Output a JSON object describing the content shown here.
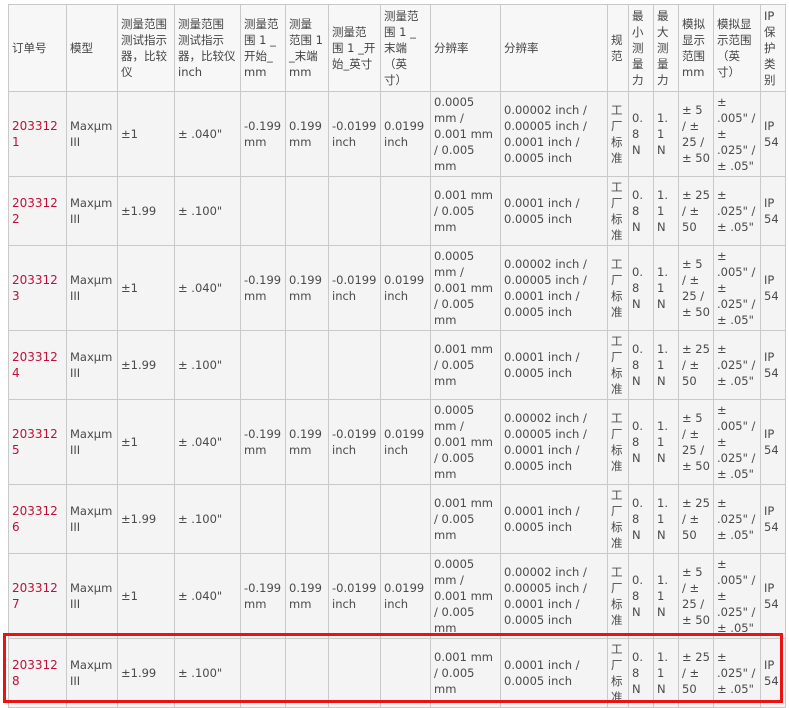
{
  "headers": [
    "订单号",
    "模型",
    "测量范围 测试指示器，比较仪",
    "测量范围 测试指示器，比较仪 inch",
    "测量范 围 1 _开始_ mm",
    "测量 范围 1 _末端 mm",
    "测量范 围 1 _开 始_英寸",
    "测量范 围 1 _ 末端 （英 寸）",
    "分辨率",
    "分辨率",
    "规 范",
    "最 小 测 量 力",
    "最 大 测 量 力",
    "模拟 显示 范围 mm",
    "模拟显 示范围 （英 寸）",
    "IP 保 护 类 别"
  ],
  "rows": [
    [
      "2033121",
      "Maxµm III",
      "±1",
      "± .040\"",
      "-0.199 mm",
      "0.199 mm",
      "-0.0199 inch",
      "0.0199 inch",
      "0.0005 mm / 0.001 mm / 0.005 mm",
      "0.00002 inch / 0.00005 inch / 0.0001 inch / 0.0005 inch",
      "工厂标准",
      "0.8 N",
      "1.1 N",
      "± 5 / ± 25 / ± 50",
      "± .005\" / ± .025\" / ± .05\"",
      "IP 54"
    ],
    [
      "2033122",
      "Maxµm III",
      "±1.99",
      "± .100\"",
      "",
      "",
      "",
      "",
      "0.001 mm / 0.005 mm",
      "0.0001 inch / 0.0005 inch",
      "工厂标准",
      "0.8 N",
      "1.1 N",
      "± 25 / ± 50",
      "± .025\" / ± .05\"",
      "IP 54"
    ],
    [
      "2033123",
      "Maxµm III",
      "±1",
      "± .040\"",
      "-0.199 mm",
      "0.199 mm",
      "-0.0199 inch",
      "0.0199 inch",
      "0.0005 mm / 0.001 mm / 0.005 mm",
      "0.00002 inch / 0.00005 inch / 0.0001 inch / 0.0005 inch",
      "工厂标准",
      "0.8 N",
      "1.1 N",
      "± 5 / ± 25 / ± 50",
      "± .005\" / ± .025\" / ± .05\"",
      "IP 54"
    ],
    [
      "2033124",
      "Maxµm III",
      "±1.99",
      "± .100\"",
      "",
      "",
      "",
      "",
      "0.001 mm / 0.005 mm",
      "0.0001 inch / 0.0005 inch",
      "工厂标准",
      "0.8 N",
      "1.1 N",
      "± 25 / ± 50",
      "± .025\" / ± .05\"",
      "IP 54"
    ],
    [
      "2033125",
      "Maxµm III",
      "±1",
      "± .040\"",
      "-0.199 mm",
      "0.199 mm",
      "-0.0199 inch",
      "0.0199 inch",
      "0.0005 mm / 0.001 mm / 0.005 mm",
      "0.00002 inch / 0.00005 inch / 0.0001 inch / 0.0005 inch",
      "工厂标准",
      "0.8 N",
      "1.1 N",
      "± 5 / ± 25 / ± 50",
      "± .005\" / ± .025\" / ± .05\"",
      "IP 54"
    ],
    [
      "2033126",
      "Maxµm III",
      "±1.99",
      "± .100\"",
      "",
      "",
      "",
      "",
      "0.001 mm / 0.005 mm",
      "0.0001 inch / 0.0005 inch",
      "工厂标准",
      "0.8 N",
      "1.1 N",
      "± 25 / ± 50",
      "± .025\" / ± .05\"",
      "IP 54"
    ],
    [
      "2033127",
      "Maxµm III",
      "±1",
      "± .040\"",
      "-0.199 mm",
      "0.199 mm",
      "-0.0199 inch",
      "0.0199 inch",
      "0.0005 mm / 0.001 mm / 0.005 mm",
      "0.00002 inch / 0.00005 inch / 0.0001 inch / 0.0005 inch",
      "工厂标准",
      "0.8 N",
      "1.1 N",
      "± 5 / ± 25 / ± 50",
      "± .005\" / ± .025\" / ± .05\"",
      "IP 54"
    ],
    [
      "2033128",
      "Maxµm III",
      "±1.99",
      "± .100\"",
      "",
      "",
      "",
      "",
      "0.001 mm / 0.005 mm",
      "0.0001 inch / 0.0005 inch",
      "工厂标准",
      "0.8 N",
      "1.1 N",
      "± 25 / ± 50",
      "± .025\" / ± .05\"",
      "IP 54"
    ]
  ],
  "highlight_color": "#ee1111",
  "order_link_color": "#c0103a"
}
